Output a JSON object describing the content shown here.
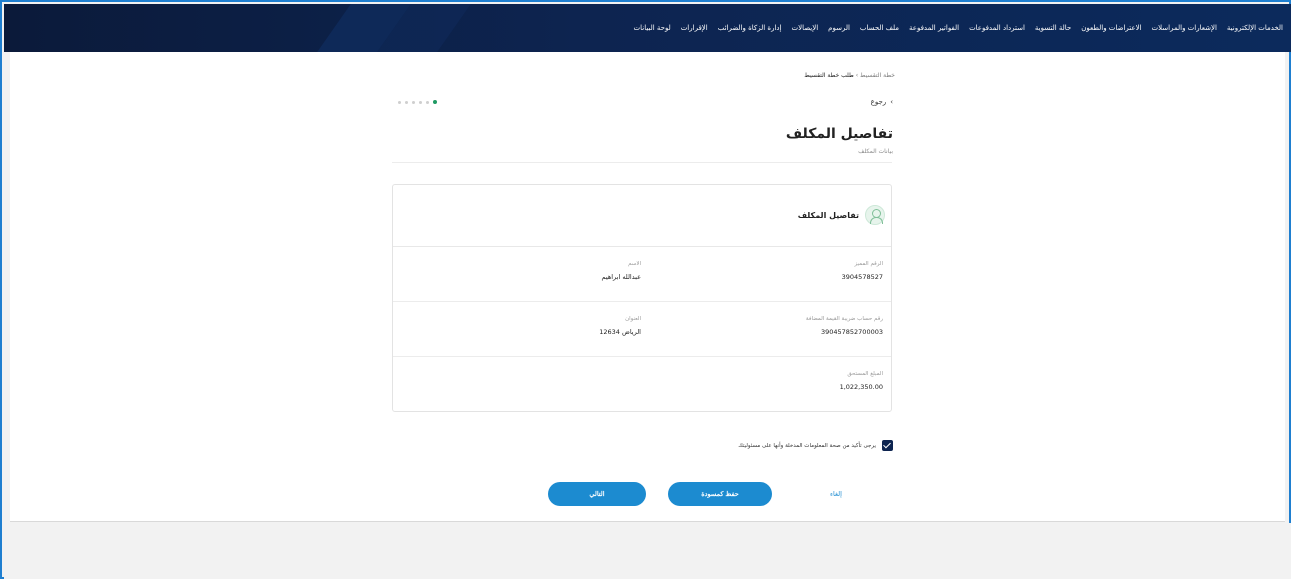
{
  "nav": {
    "items": [
      "لوحة البيانات",
      "الإقرارات",
      "إدارة الزكاة والضرائب",
      "الإيصالات",
      "الرسوم",
      "ملف الحساب",
      "الفواتير المدفوعة",
      "استرداد المدفوعات",
      "حالة التسوية",
      "الاعتراضات والطعون",
      "الإشعارات والمراسلات",
      "الخدمات الإلكترونية"
    ]
  },
  "breadcrumb": {
    "parent": "خطة التقسيط",
    "separator": "›",
    "current": "طلب خطة التقسيط"
  },
  "back_label": "رجوع",
  "page": {
    "title": "تفاصيل المكلف",
    "subtitle": "بيانات المكلف"
  },
  "panel": {
    "title": "تفاصيل المكلف",
    "rows": [
      [
        {
          "label": "الرقم المميز",
          "value": "3904578527"
        },
        {
          "label": "الاسم",
          "value": "عبدالله ابراهيم"
        }
      ],
      [
        {
          "label": "رقم حساب ضريبة القيمة المضافة",
          "value": "390457852700003"
        },
        {
          "label": "العنوان",
          "value": "الرياض 12634"
        }
      ],
      [
        {
          "label": "المبلغ المستحق",
          "value": "1,022,350.00"
        }
      ]
    ]
  },
  "consent": {
    "checked": true,
    "text": "يرجى تأكيد من صحة المعلومات المدخلة وأنها على مسئوليتك"
  },
  "buttons": {
    "next": "التالي",
    "save_draft": "حفظ كمسودة",
    "cancel": "إلغاء"
  }
}
